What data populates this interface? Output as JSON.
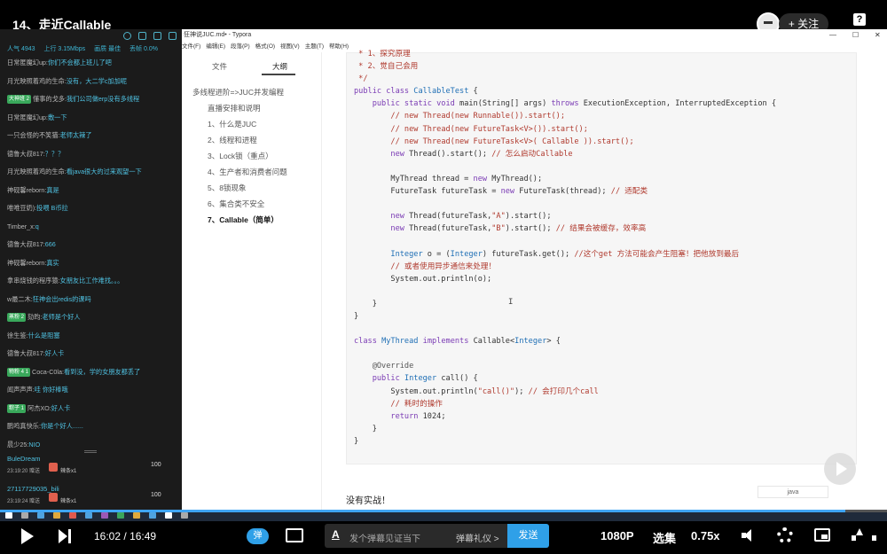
{
  "video": {
    "title": "14、走近Callable",
    "follow_label": "+ 关注",
    "help": "?"
  },
  "chat": {
    "stats": [
      "人气 4943",
      "上行 3.15Mbps",
      "画质 最佳",
      "丢帧 0.0%"
    ],
    "messages": [
      {
        "user": "日常匿魔幻up:",
        "text": "你们不会都上班儿了吧"
      },
      {
        "user": "月光映照着鸡的生命:",
        "text": "没有，大二学c加加呢"
      },
      {
        "badge": "大神班 2",
        "user": "懂事的戈多:",
        "text": "我们公司做erp没有多线程"
      },
      {
        "user": "日常匿魔幻up:",
        "text": "敷一下"
      },
      {
        "user": "一只会怪的不笑猫:",
        "text": "老师太辣了"
      },
      {
        "user": "德鲁大叔817:",
        "text": "？？？"
      },
      {
        "user": "月光映照着鸡的生命:",
        "text": "看java很大的过来观望一下"
      },
      {
        "user": "神砚馨reborn:",
        "text": "真是"
      },
      {
        "user": "唯唯豆奶):",
        "text": "投喂 B币拉"
      },
      {
        "user": "Timber_x:",
        "text": "q"
      },
      {
        "user": "德鲁大叔817:",
        "text": "666"
      },
      {
        "user": "神砚馨reborn:",
        "text": "真实"
      },
      {
        "user": "拿串烧钱的程序猿:",
        "text": "女朋友比工作难找。。。"
      },
      {
        "user": "w最二木:",
        "text": "狂神会出redis的课吗"
      },
      {
        "badge": "蒸粉 2",
        "user": "劾昀:",
        "text": "老师是个好人"
      },
      {
        "user": "徐生鉴:",
        "text": "什么是阻塞"
      },
      {
        "user": "德鲁大叔817:",
        "text": "好人卡"
      },
      {
        "badge": "物粉 4 1",
        "user": "Coca-C0la:",
        "text": "看到没，学的女朋友都丢了"
      },
      {
        "user": "闻声声声:",
        "text": "哇 你好棒哦"
      },
      {
        "badge": "粽子 1",
        "user": "阿杰XO:",
        "text": "好人卡"
      },
      {
        "user": "鹏鸣真快乐:",
        "text": "你是个好人......"
      },
      {
        "user": "晨少25:",
        "text": "NIO"
      }
    ],
    "gifts": [
      {
        "user": "BuleDream",
        "time": "23:19:20 赠送",
        "item": "辣条x1",
        "count": "100"
      },
      {
        "user": "27117729035_bili",
        "time": "23:19:24 赠送",
        "item": "辣条x1",
        "count": "100"
      }
    ]
  },
  "typora": {
    "window_title": "狂神说JUC.md• - Typora",
    "menu": [
      "文件(F)",
      "编辑(E)",
      "段落(P)",
      "格式(O)",
      "视图(V)",
      "主题(T)",
      "帮助(H)"
    ],
    "tabs": {
      "file": "文件",
      "outline": "大纲"
    },
    "outline": [
      {
        "label": "多线程进阶=>JUC并发编程",
        "level": 0
      },
      {
        "label": "直播安排和说明",
        "level": 1
      },
      {
        "label": "1、什么是JUC",
        "level": 1
      },
      {
        "label": "2、线程和进程",
        "level": 1
      },
      {
        "label": "3、Lock锁（重点）",
        "level": 1
      },
      {
        "label": "4、生产者和消费者问题",
        "level": 1
      },
      {
        "label": "5、8锁现象",
        "level": 1
      },
      {
        "label": "6、集合类不安全",
        "level": 1
      },
      {
        "label": "7、Callable（简单）",
        "level": 1,
        "current": true
      }
    ],
    "footer_icons": "<  </>",
    "code_lang": "java",
    "paragraph": "没有实战！"
  },
  "player": {
    "current_time": "16:02",
    "separator": "/",
    "total_time": "16:49",
    "progress": 0.953,
    "danmu_toggle": "弹",
    "danmu_placeholder": "发个弹幕见证当下",
    "danmu_etiquette": "弹幕礼仪 >",
    "send_label": "发送",
    "quality": "1080P",
    "episodes": "选集",
    "speed": "0.75x"
  },
  "colors": {
    "accent": "#2fa0e8",
    "chat_text": "#4fc1e1",
    "keyword": "#7a3bb4",
    "type": "#1f6fb5",
    "comment": "#b03a2e"
  }
}
